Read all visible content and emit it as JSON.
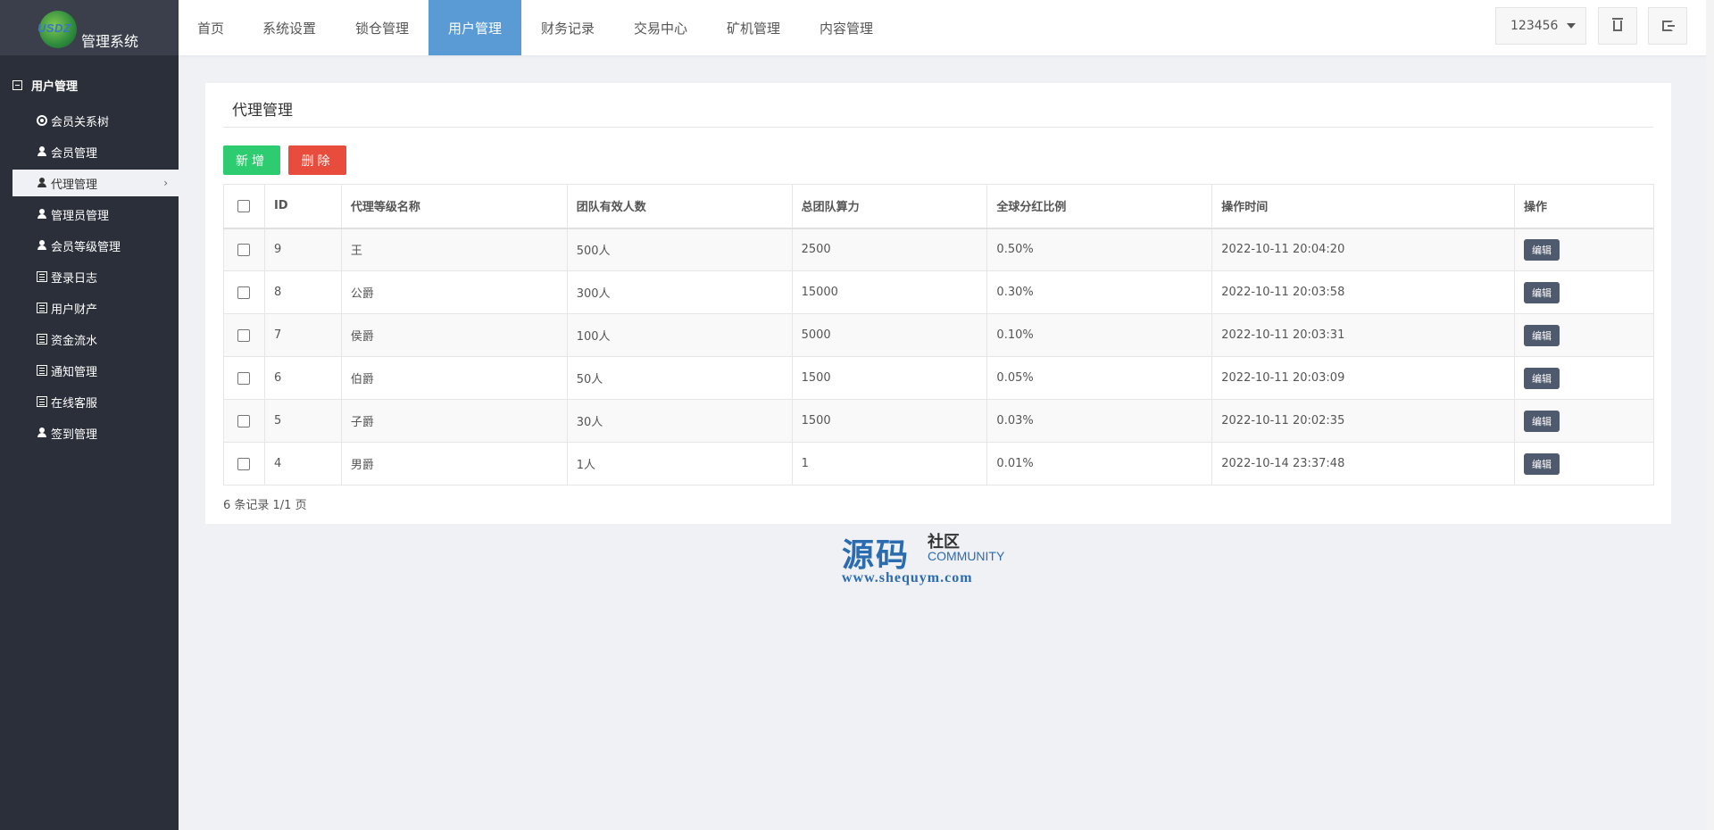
{
  "app": {
    "logo_text": "USDZ",
    "title": "管理系统"
  },
  "topnav": [
    {
      "label": "首页"
    },
    {
      "label": "系统设置"
    },
    {
      "label": "锁仓管理"
    },
    {
      "label": "用户管理"
    },
    {
      "label": "财务记录"
    },
    {
      "label": "交易中心"
    },
    {
      "label": "矿机管理"
    },
    {
      "label": "内容管理"
    }
  ],
  "topnav_active_index": 3,
  "user": {
    "name": "123456"
  },
  "sidebar": {
    "group_label": "用户管理",
    "items": [
      {
        "label": "会员关系树",
        "icon": "target-icon"
      },
      {
        "label": "会员管理",
        "icon": "user-icon"
      },
      {
        "label": "代理管理",
        "icon": "user-icon"
      },
      {
        "label": "管理员管理",
        "icon": "user-icon"
      },
      {
        "label": "会员等级管理",
        "icon": "user-icon"
      },
      {
        "label": "登录日志",
        "icon": "list-icon"
      },
      {
        "label": "用户财产",
        "icon": "list-icon"
      },
      {
        "label": "资金流水",
        "icon": "list-icon"
      },
      {
        "label": "通知管理",
        "icon": "list-icon"
      },
      {
        "label": "在线客服",
        "icon": "list-icon"
      },
      {
        "label": "签到管理",
        "icon": "user-icon"
      }
    ],
    "active_index": 2
  },
  "panel": {
    "title": "代理管理",
    "add_label": "新增",
    "delete_label": "删除",
    "columns": [
      "ID",
      "代理等级名称",
      "团队有效人数",
      "总团队算力",
      "全球分红比例",
      "操作时间",
      "操作"
    ],
    "rows": [
      {
        "id": "9",
        "name": "王",
        "members": "500人",
        "power": "2500",
        "ratio": "0.50%",
        "time": "2022-10-11 20:04:20",
        "action": "编辑"
      },
      {
        "id": "8",
        "name": "公爵",
        "members": "300人",
        "power": "15000",
        "ratio": "0.30%",
        "time": "2022-10-11 20:03:58",
        "action": "编辑"
      },
      {
        "id": "7",
        "name": "侯爵",
        "members": "100人",
        "power": "5000",
        "ratio": "0.10%",
        "time": "2022-10-11 20:03:31",
        "action": "编辑"
      },
      {
        "id": "6",
        "name": "伯爵",
        "members": "50人",
        "power": "1500",
        "ratio": "0.05%",
        "time": "2022-10-11 20:03:09",
        "action": "编辑"
      },
      {
        "id": "5",
        "name": "子爵",
        "members": "30人",
        "power": "1500",
        "ratio": "0.03%",
        "time": "2022-10-11 20:02:35",
        "action": "编辑"
      },
      {
        "id": "4",
        "name": "男爵",
        "members": "1人",
        "power": "1",
        "ratio": "0.01%",
        "time": "2022-10-14 23:37:48",
        "action": "编辑"
      }
    ],
    "pager_text": "6 条记录 1/1 页"
  },
  "watermark": {
    "big": "源码",
    "small": "社区",
    "community": "COMMUNITY",
    "url": "www.shequym.com"
  },
  "colors": {
    "sidebar_bg": "#2b2f3a",
    "nav_active": "#5b9bd5",
    "add_button": "#2ecc71",
    "delete_button": "#e74c3c",
    "edit_button": "#505a6e"
  }
}
